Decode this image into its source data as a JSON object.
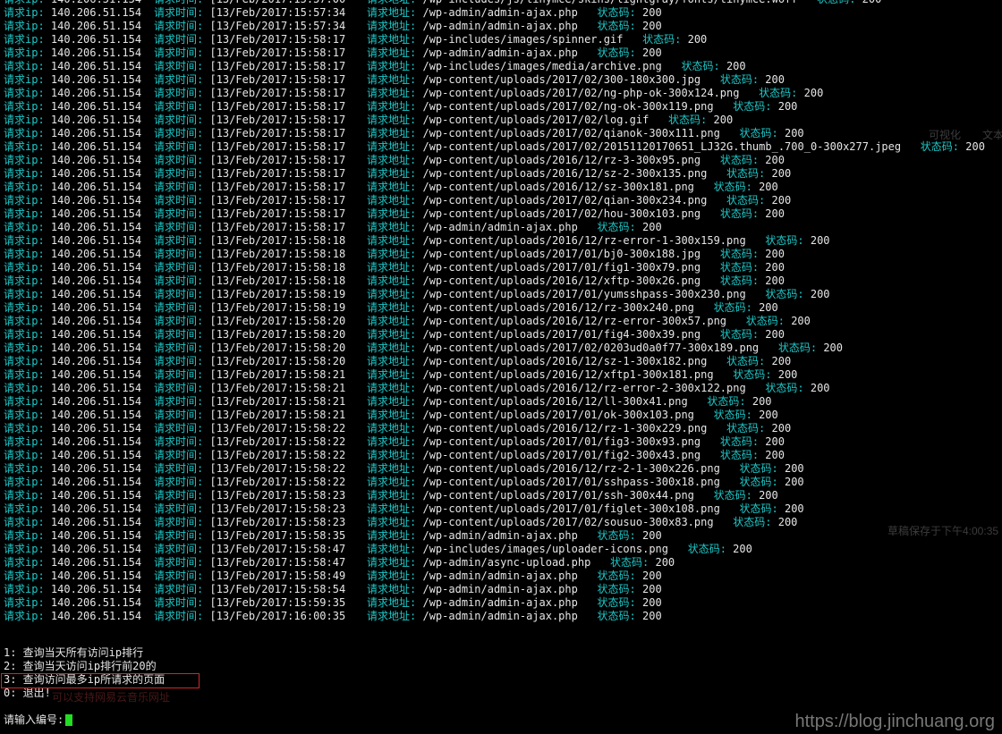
{
  "labels": {
    "ip": "请求ip:",
    "time": "请求时间:",
    "url": "请求地址:",
    "status": "状态码:"
  },
  "log_rows": [
    {
      "ip": "140.206.51.154",
      "time": "[13/Feb/2017:15:57:00",
      "url": "/wp-includes/js/tinymce/skins/lightgray/fonts/tinymce.woff",
      "status": "200"
    },
    {
      "ip": "140.206.51.154",
      "time": "[13/Feb/2017:15:57:34",
      "url": "/wp-admin/admin-ajax.php",
      "status": "200"
    },
    {
      "ip": "140.206.51.154",
      "time": "[13/Feb/2017:15:57:34",
      "url": "/wp-admin/admin-ajax.php",
      "status": "200"
    },
    {
      "ip": "140.206.51.154",
      "time": "[13/Feb/2017:15:58:17",
      "url": "/wp-includes/images/spinner.gif",
      "status": "200"
    },
    {
      "ip": "140.206.51.154",
      "time": "[13/Feb/2017:15:58:17",
      "url": "/wp-admin/admin-ajax.php",
      "status": "200"
    },
    {
      "ip": "140.206.51.154",
      "time": "[13/Feb/2017:15:58:17",
      "url": "/wp-includes/images/media/archive.png",
      "status": "200"
    },
    {
      "ip": "140.206.51.154",
      "time": "[13/Feb/2017:15:58:17",
      "url": "/wp-content/uploads/2017/02/300-180x300.jpg",
      "status": "200"
    },
    {
      "ip": "140.206.51.154",
      "time": "[13/Feb/2017:15:58:17",
      "url": "/wp-content/uploads/2017/02/ng-php-ok-300x124.png",
      "status": "200"
    },
    {
      "ip": "140.206.51.154",
      "time": "[13/Feb/2017:15:58:17",
      "url": "/wp-content/uploads/2017/02/ng-ok-300x119.png",
      "status": "200"
    },
    {
      "ip": "140.206.51.154",
      "time": "[13/Feb/2017:15:58:17",
      "url": "/wp-content/uploads/2017/02/log.gif",
      "status": "200"
    },
    {
      "ip": "140.206.51.154",
      "time": "[13/Feb/2017:15:58:17",
      "url": "/wp-content/uploads/2017/02/qianok-300x111.png",
      "status": "200"
    },
    {
      "ip": "140.206.51.154",
      "time": "[13/Feb/2017:15:58:17",
      "url": "/wp-content/uploads/2017/02/20151120170651_LJ32G.thumb_.700_0-300x277.jpeg",
      "status": "200"
    },
    {
      "ip": "140.206.51.154",
      "time": "[13/Feb/2017:15:58:17",
      "url": "/wp-content/uploads/2016/12/rz-3-300x95.png",
      "status": "200"
    },
    {
      "ip": "140.206.51.154",
      "time": "[13/Feb/2017:15:58:17",
      "url": "/wp-content/uploads/2016/12/sz-2-300x135.png",
      "status": "200"
    },
    {
      "ip": "140.206.51.154",
      "time": "[13/Feb/2017:15:58:17",
      "url": "/wp-content/uploads/2016/12/sz-300x181.png",
      "status": "200"
    },
    {
      "ip": "140.206.51.154",
      "time": "[13/Feb/2017:15:58:17",
      "url": "/wp-content/uploads/2017/02/qian-300x234.png",
      "status": "200"
    },
    {
      "ip": "140.206.51.154",
      "time": "[13/Feb/2017:15:58:17",
      "url": "/wp-content/uploads/2017/02/hou-300x103.png",
      "status": "200"
    },
    {
      "ip": "140.206.51.154",
      "time": "[13/Feb/2017:15:58:17",
      "url": "/wp-admin/admin-ajax.php",
      "status": "200"
    },
    {
      "ip": "140.206.51.154",
      "time": "[13/Feb/2017:15:58:18",
      "url": "/wp-content/uploads/2016/12/rz-error-1-300x159.png",
      "status": "200"
    },
    {
      "ip": "140.206.51.154",
      "time": "[13/Feb/2017:15:58:18",
      "url": "/wp-content/uploads/2017/01/bj0-300x188.jpg",
      "status": "200"
    },
    {
      "ip": "140.206.51.154",
      "time": "[13/Feb/2017:15:58:18",
      "url": "/wp-content/uploads/2017/01/fig1-300x79.png",
      "status": "200"
    },
    {
      "ip": "140.206.51.154",
      "time": "[13/Feb/2017:15:58:18",
      "url": "/wp-content/uploads/2016/12/xftp-300x26.png",
      "status": "200"
    },
    {
      "ip": "140.206.51.154",
      "time": "[13/Feb/2017:15:58:19",
      "url": "/wp-content/uploads/2017/01/yumsshpass-300x230.png",
      "status": "200"
    },
    {
      "ip": "140.206.51.154",
      "time": "[13/Feb/2017:15:58:19",
      "url": "/wp-content/uploads/2016/12/rz-300x240.png",
      "status": "200"
    },
    {
      "ip": "140.206.51.154",
      "time": "[13/Feb/2017:15:58:20",
      "url": "/wp-content/uploads/2016/12/rz-error-300x57.png",
      "status": "200"
    },
    {
      "ip": "140.206.51.154",
      "time": "[13/Feb/2017:15:58:20",
      "url": "/wp-content/uploads/2017/01/fig4-300x39.png",
      "status": "200"
    },
    {
      "ip": "140.206.51.154",
      "time": "[13/Feb/2017:15:58:20",
      "url": "/wp-content/uploads/2017/02/0203ud0a0f77-300x189.png",
      "status": "200"
    },
    {
      "ip": "140.206.51.154",
      "time": "[13/Feb/2017:15:58:20",
      "url": "/wp-content/uploads/2016/12/sz-1-300x182.png",
      "status": "200"
    },
    {
      "ip": "140.206.51.154",
      "time": "[13/Feb/2017:15:58:21",
      "url": "/wp-content/uploads/2016/12/xftp1-300x181.png",
      "status": "200"
    },
    {
      "ip": "140.206.51.154",
      "time": "[13/Feb/2017:15:58:21",
      "url": "/wp-content/uploads/2016/12/rz-error-2-300x122.png",
      "status": "200"
    },
    {
      "ip": "140.206.51.154",
      "time": "[13/Feb/2017:15:58:21",
      "url": "/wp-content/uploads/2016/12/ll-300x41.png",
      "status": "200"
    },
    {
      "ip": "140.206.51.154",
      "time": "[13/Feb/2017:15:58:21",
      "url": "/wp-content/uploads/2017/01/ok-300x103.png",
      "status": "200"
    },
    {
      "ip": "140.206.51.154",
      "time": "[13/Feb/2017:15:58:22",
      "url": "/wp-content/uploads/2016/12/rz-1-300x229.png",
      "status": "200"
    },
    {
      "ip": "140.206.51.154",
      "time": "[13/Feb/2017:15:58:22",
      "url": "/wp-content/uploads/2017/01/fig3-300x93.png",
      "status": "200"
    },
    {
      "ip": "140.206.51.154",
      "time": "[13/Feb/2017:15:58:22",
      "url": "/wp-content/uploads/2017/01/fig2-300x43.png",
      "status": "200"
    },
    {
      "ip": "140.206.51.154",
      "time": "[13/Feb/2017:15:58:22",
      "url": "/wp-content/uploads/2016/12/rz-2-1-300x226.png",
      "status": "200"
    },
    {
      "ip": "140.206.51.154",
      "time": "[13/Feb/2017:15:58:22",
      "url": "/wp-content/uploads/2017/01/sshpass-300x18.png",
      "status": "200"
    },
    {
      "ip": "140.206.51.154",
      "time": "[13/Feb/2017:15:58:23",
      "url": "/wp-content/uploads/2017/01/ssh-300x44.png",
      "status": "200"
    },
    {
      "ip": "140.206.51.154",
      "time": "[13/Feb/2017:15:58:23",
      "url": "/wp-content/uploads/2017/01/figlet-300x108.png",
      "status": "200"
    },
    {
      "ip": "140.206.51.154",
      "time": "[13/Feb/2017:15:58:23",
      "url": "/wp-content/uploads/2017/02/sousuo-300x83.png",
      "status": "200"
    },
    {
      "ip": "140.206.51.154",
      "time": "[13/Feb/2017:15:58:35",
      "url": "/wp-admin/admin-ajax.php",
      "status": "200"
    },
    {
      "ip": "140.206.51.154",
      "time": "[13/Feb/2017:15:58:47",
      "url": "/wp-includes/images/uploader-icons.png",
      "status": "200"
    },
    {
      "ip": "140.206.51.154",
      "time": "[13/Feb/2017:15:58:47",
      "url": "/wp-admin/async-upload.php",
      "status": "200"
    },
    {
      "ip": "140.206.51.154",
      "time": "[13/Feb/2017:15:58:49",
      "url": "/wp-admin/admin-ajax.php",
      "status": "200"
    },
    {
      "ip": "140.206.51.154",
      "time": "[13/Feb/2017:15:58:54",
      "url": "/wp-admin/admin-ajax.php",
      "status": "200"
    },
    {
      "ip": "140.206.51.154",
      "time": "[13/Feb/2017:15:59:35",
      "url": "/wp-admin/admin-ajax.php",
      "status": "200"
    },
    {
      "ip": "140.206.51.154",
      "time": "[13/Feb/2017:16:00:35",
      "url": "/wp-admin/admin-ajax.php",
      "status": "200"
    }
  ],
  "menu": {
    "opt1": "1: 查询当天所有访问ip排行",
    "opt2": "2: 查询当天访问ip排行前20的",
    "opt3": "3: 查询访问最多ip所请求的页面",
    "opt0": "0: 退出!"
  },
  "prompt": {
    "label": "请输入编号:"
  },
  "background_window": {
    "tab_visual": "可视化",
    "tab_text": "文本",
    "draft_saved": "草稿保存于下午4:00:35",
    "hint": "可以支持网易云音乐网址"
  },
  "watermark": "https://blog.jinchuang.org",
  "colors": {
    "label": "#1ec8c8",
    "value": "#e6e6e6",
    "highlight_border": "#d02828",
    "cursor": "#22dd22",
    "background": "#000000"
  }
}
